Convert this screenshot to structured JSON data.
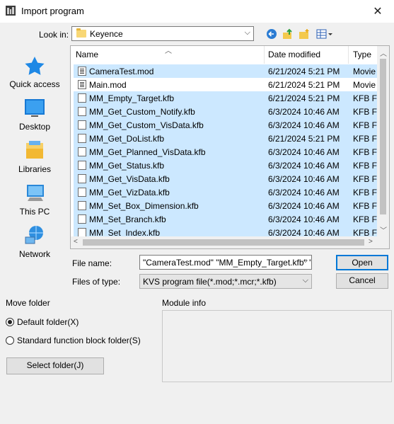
{
  "window": {
    "title": "Import program",
    "close_label": "✕"
  },
  "lookin": {
    "label": "Look in:",
    "value": "Keyence"
  },
  "places": [
    {
      "label": "Quick access",
      "icon": "quick-access-star-icon"
    },
    {
      "label": "Desktop",
      "icon": "desktop-icon"
    },
    {
      "label": "Libraries",
      "icon": "libraries-icon"
    },
    {
      "label": "This PC",
      "icon": "this-pc-icon"
    },
    {
      "label": "Network",
      "icon": "network-icon"
    }
  ],
  "files": {
    "columns": {
      "name": "Name",
      "date": "Date modified",
      "type": "Type"
    },
    "rows": [
      {
        "name": "CameraTest.mod",
        "date": "6/21/2024 5:21 PM",
        "type": "Movie"
      },
      {
        "name": "Main.mod",
        "date": "6/21/2024 5:21 PM",
        "type": "Movie"
      },
      {
        "name": "MM_Empty_Target.kfb",
        "date": "6/21/2024 5:21 PM",
        "type": "KFB Fil"
      },
      {
        "name": "MM_Get_Custom_Notify.kfb",
        "date": "6/3/2024 10:46 AM",
        "type": "KFB Fil"
      },
      {
        "name": "MM_Get_Custom_VisData.kfb",
        "date": "6/3/2024 10:46 AM",
        "type": "KFB Fil"
      },
      {
        "name": "MM_Get_DoList.kfb",
        "date": "6/21/2024 5:21 PM",
        "type": "KFB Fil"
      },
      {
        "name": "MM_Get_Planned_VisData.kfb",
        "date": "6/3/2024 10:46 AM",
        "type": "KFB Fil"
      },
      {
        "name": "MM_Get_Status.kfb",
        "date": "6/3/2024 10:46 AM",
        "type": "KFB Fil"
      },
      {
        "name": "MM_Get_VisData.kfb",
        "date": "6/3/2024 10:46 AM",
        "type": "KFB Fil"
      },
      {
        "name": "MM_Get_VizData.kfb",
        "date": "6/3/2024 10:46 AM",
        "type": "KFB Fil"
      },
      {
        "name": "MM_Set_Box_Dimension.kfb",
        "date": "6/3/2024 10:46 AM",
        "type": "KFB Fil"
      },
      {
        "name": "MM_Set_Branch.kfb",
        "date": "6/3/2024 10:46 AM",
        "type": "KFB Fil"
      },
      {
        "name": "MM_Set_Index.kfb",
        "date": "6/3/2024 10:46 AM",
        "type": "KFB Fil"
      }
    ]
  },
  "filename": {
    "label": "File name:",
    "value": "\"CameraTest.mod\" \"MM_Empty_Target.kfb\" \"M"
  },
  "filetype": {
    "label": "Files of type:",
    "value": "KVS program file(*.mod;*.mcr;*.kfb)"
  },
  "buttons": {
    "open": "Open",
    "cancel": "Cancel",
    "select_folder": "Select folder(J)"
  },
  "move_folder": {
    "title": "Move folder",
    "option_default": "Default folder(X)",
    "option_standard": "Standard function block folder(S)"
  },
  "module_info": {
    "title": "Module info"
  },
  "colors": {
    "selection": "#cce8ff",
    "accent": "#0078d7"
  }
}
